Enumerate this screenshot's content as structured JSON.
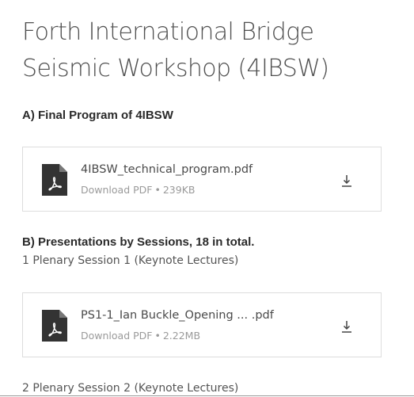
{
  "page": {
    "title": "Forth International Bridge Seismic Workshop (4IBSW)"
  },
  "section_a": {
    "heading": "A)  Final Program of 4IBSW",
    "files": [
      {
        "name": "4IBSW_technical_program.pdf",
        "type": "Download PDF",
        "separator": "•",
        "size": "239KB",
        "file_icon": "pdf-file-icon",
        "download_icon": "download-icon"
      }
    ]
  },
  "section_b": {
    "heading": "B) Presentations by Sessions, 18 in total.",
    "sessions": [
      {
        "label": "1 Plenary Session 1 (Keynote Lectures)",
        "files": [
          {
            "name": "PS1-1_Ian Buckle_Opening ... .pdf",
            "type": "Download PDF",
            "separator": "•",
            "size": "2.22MB",
            "file_icon": "pdf-file-icon",
            "download_icon": "download-icon"
          }
        ]
      },
      {
        "label": "2 Plenary Session 2 (Keynote Lectures)"
      }
    ]
  },
  "colors": {
    "icon_dark": "#333333",
    "card_border": "#dddddd",
    "meta_gray": "#9a9a9a"
  }
}
